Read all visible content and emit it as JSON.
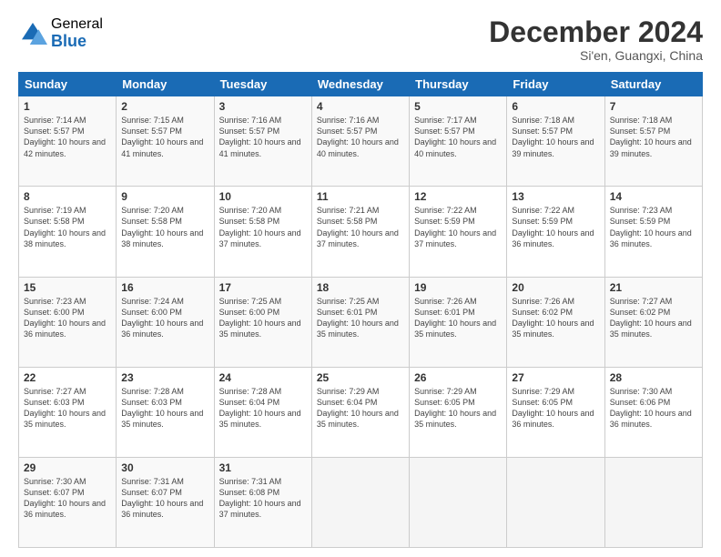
{
  "logo": {
    "general": "General",
    "blue": "Blue"
  },
  "header": {
    "title": "December 2024",
    "location": "Si'en, Guangxi, China"
  },
  "days": [
    "Sunday",
    "Monday",
    "Tuesday",
    "Wednesday",
    "Thursday",
    "Friday",
    "Saturday"
  ],
  "weeks": [
    [
      {
        "day": 1,
        "sunrise": "7:14 AM",
        "sunset": "5:57 PM",
        "daylight": "10 hours and 42 minutes."
      },
      {
        "day": 2,
        "sunrise": "7:15 AM",
        "sunset": "5:57 PM",
        "daylight": "10 hours and 41 minutes."
      },
      {
        "day": 3,
        "sunrise": "7:16 AM",
        "sunset": "5:57 PM",
        "daylight": "10 hours and 41 minutes."
      },
      {
        "day": 4,
        "sunrise": "7:16 AM",
        "sunset": "5:57 PM",
        "daylight": "10 hours and 40 minutes."
      },
      {
        "day": 5,
        "sunrise": "7:17 AM",
        "sunset": "5:57 PM",
        "daylight": "10 hours and 40 minutes."
      },
      {
        "day": 6,
        "sunrise": "7:18 AM",
        "sunset": "5:57 PM",
        "daylight": "10 hours and 39 minutes."
      },
      {
        "day": 7,
        "sunrise": "7:18 AM",
        "sunset": "5:57 PM",
        "daylight": "10 hours and 39 minutes."
      }
    ],
    [
      {
        "day": 8,
        "sunrise": "7:19 AM",
        "sunset": "5:58 PM",
        "daylight": "10 hours and 38 minutes."
      },
      {
        "day": 9,
        "sunrise": "7:20 AM",
        "sunset": "5:58 PM",
        "daylight": "10 hours and 38 minutes."
      },
      {
        "day": 10,
        "sunrise": "7:20 AM",
        "sunset": "5:58 PM",
        "daylight": "10 hours and 37 minutes."
      },
      {
        "day": 11,
        "sunrise": "7:21 AM",
        "sunset": "5:58 PM",
        "daylight": "10 hours and 37 minutes."
      },
      {
        "day": 12,
        "sunrise": "7:22 AM",
        "sunset": "5:59 PM",
        "daylight": "10 hours and 37 minutes."
      },
      {
        "day": 13,
        "sunrise": "7:22 AM",
        "sunset": "5:59 PM",
        "daylight": "10 hours and 36 minutes."
      },
      {
        "day": 14,
        "sunrise": "7:23 AM",
        "sunset": "5:59 PM",
        "daylight": "10 hours and 36 minutes."
      }
    ],
    [
      {
        "day": 15,
        "sunrise": "7:23 AM",
        "sunset": "6:00 PM",
        "daylight": "10 hours and 36 minutes."
      },
      {
        "day": 16,
        "sunrise": "7:24 AM",
        "sunset": "6:00 PM",
        "daylight": "10 hours and 36 minutes."
      },
      {
        "day": 17,
        "sunrise": "7:25 AM",
        "sunset": "6:00 PM",
        "daylight": "10 hours and 35 minutes."
      },
      {
        "day": 18,
        "sunrise": "7:25 AM",
        "sunset": "6:01 PM",
        "daylight": "10 hours and 35 minutes."
      },
      {
        "day": 19,
        "sunrise": "7:26 AM",
        "sunset": "6:01 PM",
        "daylight": "10 hours and 35 minutes."
      },
      {
        "day": 20,
        "sunrise": "7:26 AM",
        "sunset": "6:02 PM",
        "daylight": "10 hours and 35 minutes."
      },
      {
        "day": 21,
        "sunrise": "7:27 AM",
        "sunset": "6:02 PM",
        "daylight": "10 hours and 35 minutes."
      }
    ],
    [
      {
        "day": 22,
        "sunrise": "7:27 AM",
        "sunset": "6:03 PM",
        "daylight": "10 hours and 35 minutes."
      },
      {
        "day": 23,
        "sunrise": "7:28 AM",
        "sunset": "6:03 PM",
        "daylight": "10 hours and 35 minutes."
      },
      {
        "day": 24,
        "sunrise": "7:28 AM",
        "sunset": "6:04 PM",
        "daylight": "10 hours and 35 minutes."
      },
      {
        "day": 25,
        "sunrise": "7:29 AM",
        "sunset": "6:04 PM",
        "daylight": "10 hours and 35 minutes."
      },
      {
        "day": 26,
        "sunrise": "7:29 AM",
        "sunset": "6:05 PM",
        "daylight": "10 hours and 35 minutes."
      },
      {
        "day": 27,
        "sunrise": "7:29 AM",
        "sunset": "6:05 PM",
        "daylight": "10 hours and 36 minutes."
      },
      {
        "day": 28,
        "sunrise": "7:30 AM",
        "sunset": "6:06 PM",
        "daylight": "10 hours and 36 minutes."
      }
    ],
    [
      {
        "day": 29,
        "sunrise": "7:30 AM",
        "sunset": "6:07 PM",
        "daylight": "10 hours and 36 minutes."
      },
      {
        "day": 30,
        "sunrise": "7:31 AM",
        "sunset": "6:07 PM",
        "daylight": "10 hours and 36 minutes."
      },
      {
        "day": 31,
        "sunrise": "7:31 AM",
        "sunset": "6:08 PM",
        "daylight": "10 hours and 37 minutes."
      },
      null,
      null,
      null,
      null
    ]
  ]
}
